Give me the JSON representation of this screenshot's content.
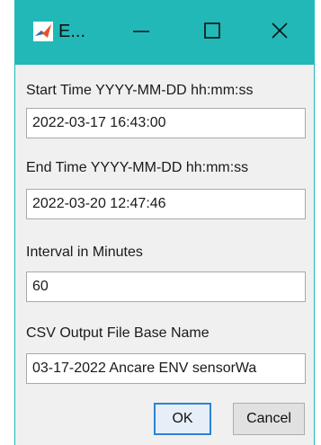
{
  "window": {
    "title": "E...",
    "icon": "matlab-icon"
  },
  "titlebar_controls": {
    "minimize": "minimize-icon",
    "maximize": "maximize-icon",
    "close": "close-icon"
  },
  "fields": [
    {
      "label": "Start Time YYYY-MM-DD hh:mm:ss",
      "value": "2022-03-17 16:43:00"
    },
    {
      "label": "End Time YYYY-MM-DD hh:mm:ss",
      "value": "2022-03-20 12:47:46"
    },
    {
      "label": "Interval in Minutes",
      "value": "60"
    },
    {
      "label": "CSV Output File Base Name",
      "value": "03-17-2022 Ancare ENV sensorWa"
    }
  ],
  "buttons": {
    "ok": "OK",
    "cancel": "Cancel"
  },
  "colors": {
    "titlebar": "#22b8b8",
    "ok_border": "#2a83d6"
  }
}
